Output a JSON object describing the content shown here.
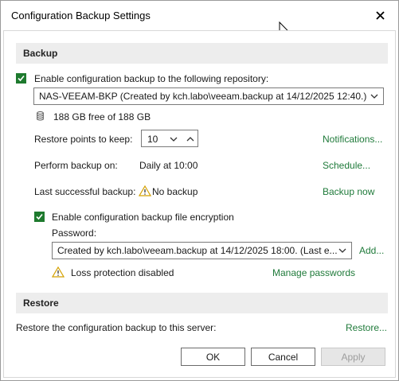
{
  "window": {
    "title": "Configuration Backup Settings",
    "close_icon": "close-icon"
  },
  "backup": {
    "header": "Backup",
    "enable_label": "Enable configuration backup to the following repository:",
    "enable_checked": true,
    "repository_value": "NAS-VEEAM-BKP (Created by kch.labo\\veeam.backup at 14/12/2025 12:40.)",
    "storage_icon": "database-icon",
    "storage_text": "188 GB free of 188 GB",
    "restore_points_label": "Restore points to keep:",
    "restore_points_value": "10",
    "notifications_link": "Notifications...",
    "perform_label": "Perform backup on:",
    "perform_value": "Daily at 10:00",
    "schedule_link": "Schedule...",
    "last_label": "Last successful backup:",
    "last_value": "No backup",
    "backup_now_link": "Backup now",
    "encryption_label": "Enable configuration backup file encryption",
    "encryption_checked": true,
    "password_label": "Password:",
    "password_value": "Created by kch.labo\\veeam.backup at 14/12/2025 18:00. (Last e...",
    "add_link": "Add...",
    "loss_protection_text": "Loss protection disabled",
    "manage_passwords_link": "Manage passwords"
  },
  "restore": {
    "header": "Restore",
    "restore_label": "Restore the configuration backup to this server:",
    "restore_link": "Restore..."
  },
  "buttons": {
    "ok": "OK",
    "cancel": "Cancel",
    "apply": "Apply"
  },
  "colors": {
    "accent_green": "#1e7a2e",
    "link_green": "#1f7a3a",
    "warning_yellow": "#e0b000"
  }
}
